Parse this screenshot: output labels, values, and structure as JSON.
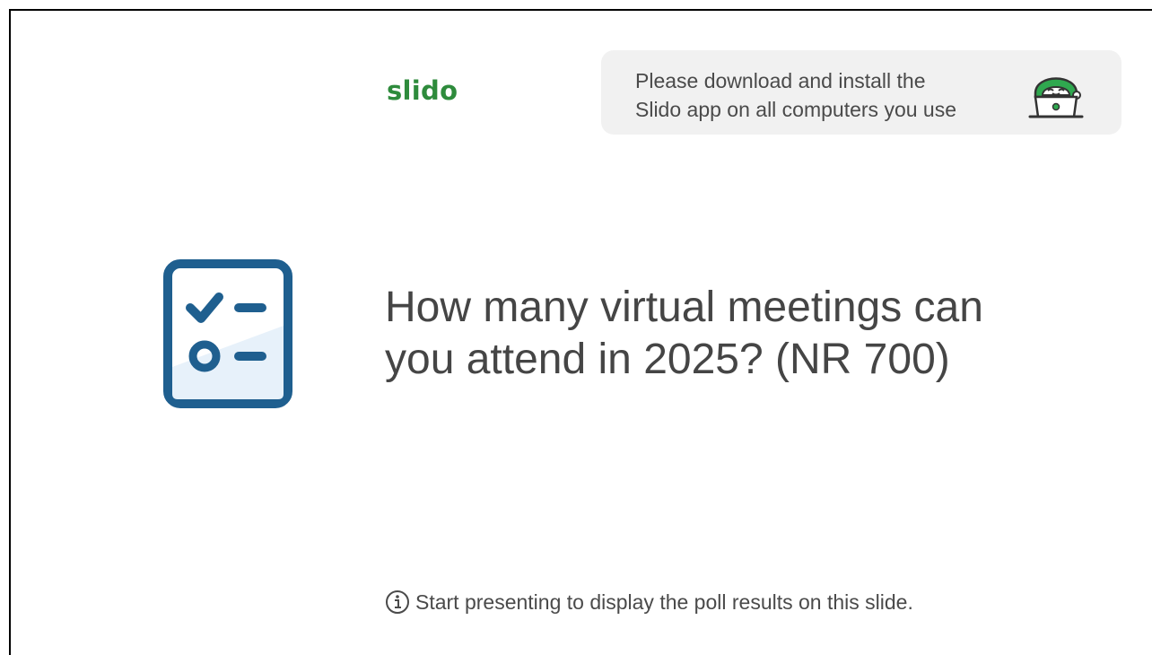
{
  "brand": {
    "logo_text": "slido",
    "brand_color": "#2e8b3c"
  },
  "banner": {
    "line1": "Please download and install the",
    "line2": "Slido app on all computers you use",
    "mascot_icon": "slido-mascot-laptop-icon"
  },
  "poll": {
    "icon": "checklist-poll-icon",
    "question_line1": "How many virtual meetings can",
    "question_line2": "you attend in 2025? (NR 700)"
  },
  "hint": {
    "icon": "info-icon",
    "text": "Start presenting to display the poll results on this slide."
  },
  "colors": {
    "icon_blue": "#1f5f8f",
    "text_dark": "#454545",
    "banner_bg": "#f1f1f1"
  }
}
